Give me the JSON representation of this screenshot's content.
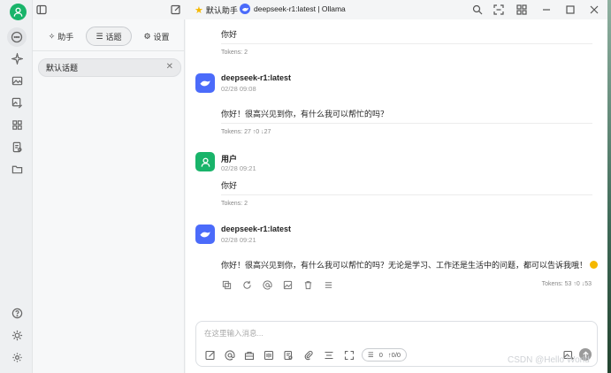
{
  "window": {
    "model_title": "deepseek-r1:latest | Ollama",
    "assistant_label": "默认助手"
  },
  "sidebar": {
    "tabs": [
      {
        "label": "助手",
        "icon": "sparkle-icon"
      },
      {
        "label": "话题",
        "icon": "list-icon",
        "active": true
      },
      {
        "label": "设置",
        "icon": "gear-icon"
      }
    ],
    "topics": [
      {
        "label": "默认话题",
        "icon": "close-icon"
      }
    ]
  },
  "rail": {
    "items": [
      "avatar",
      "chat-icon",
      "sparkle-icon",
      "image-icon",
      "image-edit-icon",
      "apps-icon",
      "document-icon",
      "folder-icon"
    ],
    "bottom": [
      "help-icon",
      "sun-icon",
      "gear-icon"
    ]
  },
  "chat": {
    "messages": [
      {
        "role": "user",
        "text": "你好",
        "tokens": "Tokens: 2"
      },
      {
        "role": "assistant",
        "name": "deepseek-r1:latest",
        "time": "02/28 09:08",
        "text": "你好！很高兴见到你，有什么我可以帮忙的吗？",
        "tokens": "Tokens: 27 ↑0 ↓27"
      },
      {
        "role": "user",
        "name": "用户",
        "time": "02/28 09:21",
        "text": "你好",
        "tokens": "Tokens: 2"
      },
      {
        "role": "assistant",
        "name": "deepseek-r1:latest",
        "time": "02/28 09:21",
        "text": "你好！很高兴见到你，有什么我可以帮忙的吗？无论是学习、工作还是生活中的问题，都可以告诉我哦！",
        "tokens": "Tokens: 53 ↑0 ↓53"
      }
    ],
    "message_actions": [
      "copy-icon",
      "refresh-icon",
      "mention-icon",
      "image-export-icon",
      "delete-icon",
      "menu-icon"
    ]
  },
  "input": {
    "placeholder": "在这里输入消息...",
    "value": "",
    "token_counts": {
      "context": "0",
      "usage": "↑0/0"
    },
    "tools": [
      "edit-icon",
      "mention-icon",
      "web-icon",
      "translate-icon",
      "knowledge-icon",
      "attach-icon",
      "clear-icon",
      "expand-icon"
    ]
  },
  "watermark": "CSDN @Hello World",
  "colors": {
    "brand_green": "#19b46a",
    "deepseek_blue": "#4b6bfa",
    "star": "#f5b800"
  }
}
